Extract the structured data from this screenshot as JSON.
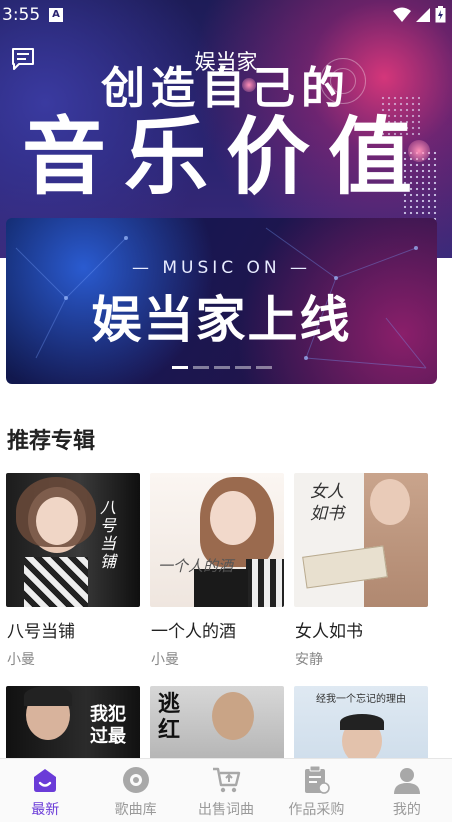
{
  "status_bar": {
    "time": "3:55",
    "notification_icon": "A"
  },
  "header": {
    "title": "娱当家"
  },
  "hero": {
    "line1": "创造自己的",
    "line2": "音乐价值"
  },
  "banner": {
    "subtitle": "— MUSIC ON —",
    "title": "娱当家上线",
    "indicator_count": 5,
    "active_index": 0
  },
  "section": {
    "title": "推荐专辑"
  },
  "albums": [
    {
      "name": "八号当铺",
      "artist": "小曼",
      "cover_text": "八号当铺"
    },
    {
      "name": "一个人的酒",
      "artist": "小曼",
      "cover_text": "一个人的酒"
    },
    {
      "name": "女人如书",
      "artist": "安静",
      "cover_text": "女人如书"
    },
    {
      "name": "",
      "artist": "",
      "cover_text": "我犯过最"
    },
    {
      "name": "",
      "artist": "",
      "cover_text": "逃红"
    },
    {
      "name": "",
      "artist": "",
      "cover_text": "经我一个忘记的理由"
    }
  ],
  "tabs": [
    {
      "label": "最新",
      "icon": "home-smile-icon",
      "active": true
    },
    {
      "label": "歌曲库",
      "icon": "disc-icon",
      "active": false
    },
    {
      "label": "出售词曲",
      "icon": "cart-icon",
      "active": false
    },
    {
      "label": "作品采购",
      "icon": "clipboard-icon",
      "active": false
    },
    {
      "label": "我的",
      "icon": "user-icon",
      "active": false
    }
  ],
  "colors": {
    "accent": "#6a3bd8",
    "tab_inactive": "#9a9a9a"
  }
}
